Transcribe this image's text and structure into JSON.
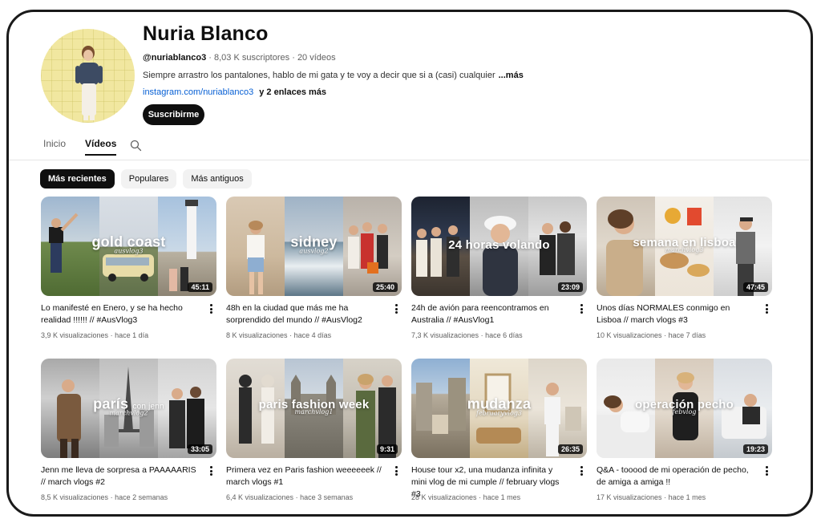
{
  "channel": {
    "name": "Nuria Blanco",
    "handle": "@nuriablanco3",
    "subscribers": "8,03 K suscriptores",
    "video_count": "20 vídeos",
    "separator": "·",
    "description": "Siempre arrastro los pantalones, hablo de mi gata y te voy a decir que si a (casi) cualquier",
    "description_fade": "",
    "more_label": "...más",
    "link": "instagram.com/nuriablanco3",
    "extra_links": "y 2 enlaces más",
    "subscribe_label": "Suscribirme"
  },
  "tabs": [
    {
      "label": "Inicio",
      "active": false
    },
    {
      "label": "Vídeos",
      "active": true
    }
  ],
  "chips": [
    {
      "label": "Más recientes",
      "active": true
    },
    {
      "label": "Populares",
      "active": false
    },
    {
      "label": "Más antiguos",
      "active": false
    }
  ],
  "videos": [
    {
      "title": "Lo manifesté en Enero, y se ha hecho realidad !!!!!! // #AusVlog3",
      "views": "3,9 K visualizaciones",
      "age": "hace 1 día",
      "duration": "45:11",
      "overlay": "gold coast",
      "overlay_sub": "ausvlog3"
    },
    {
      "title": "48h en la ciudad que más me ha sorprendido del mundo // #AusVlog2",
      "views": "8 K visualizaciones",
      "age": "hace 4 días",
      "duration": "25:40",
      "overlay": "sidney",
      "overlay_sub": "ausvlog2"
    },
    {
      "title": "24h de avión para reencontramos en Australia // #AusVlog1",
      "views": "7,3 K visualizaciones",
      "age": "hace 6 días",
      "duration": "23:09",
      "overlay": "24 horas volando",
      "overlay_sub": ""
    },
    {
      "title": "Unos días NORMALES conmigo en Lisboa // march vlogs #3",
      "views": "10 K visualizaciones",
      "age": "hace 7 días",
      "duration": "47:45",
      "overlay": "semana en lisboa",
      "overlay_sub": "marchvlog3"
    },
    {
      "title": "Jenn me lleva de sorpresa a PAAAAARIS // march vlogs #2",
      "views": "8,5 K visualizaciones",
      "age": "hace 2 semanas",
      "duration": "33:05",
      "overlay": "parís",
      "overlay_sub": "marchvlog2",
      "overlay_extra": "con jenn"
    },
    {
      "title": "Primera vez en Paris fashion weeeeeek // march vlogs #1",
      "views": "6,4 K visualizaciones",
      "age": "hace 3 semanas",
      "duration": "9:31",
      "overlay": "paris fashion week",
      "overlay_sub": "marchvlog1"
    },
    {
      "title": "House tour x2, una mudanza infinita y mini vlog de mi cumple // february vlogs #3",
      "views": "28 K visualizaciones",
      "age": "hace 1 mes",
      "duration": "26:35",
      "overlay": "mudanza",
      "overlay_sub": "februaryvlog3"
    },
    {
      "title": "Q&A - tooood de mi operación de pecho, de amiga a amiga !!",
      "views": "17 K visualizaciones",
      "age": "hace 1 mes",
      "duration": "19:23",
      "overlay": "operación pecho",
      "overlay_sub": "febvlog"
    }
  ],
  "colors": {
    "link": "#065fd4",
    "primary": "#0f0f0f",
    "secondary": "#606060",
    "chip_bg": "#f2f2f2"
  }
}
